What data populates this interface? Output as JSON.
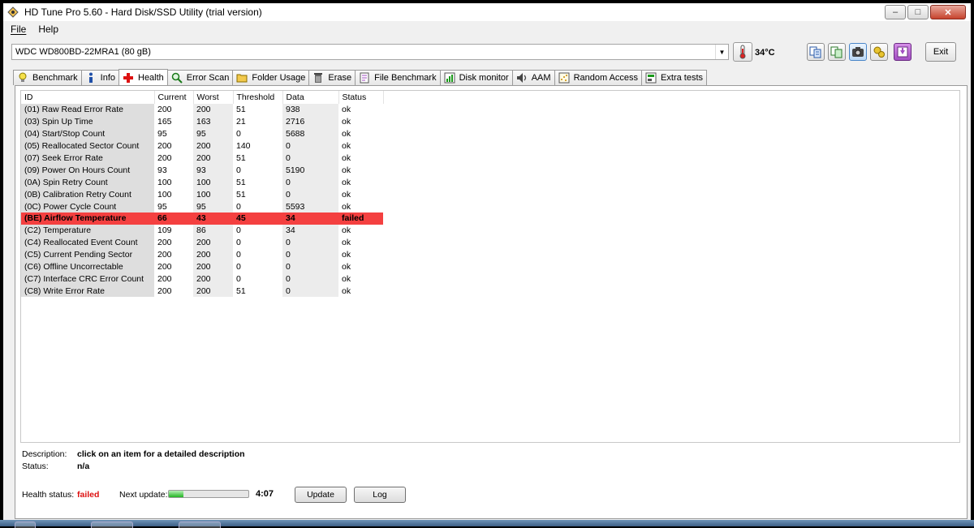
{
  "window": {
    "title": "HD Tune Pro 5.60 - Hard Disk/SSD Utility (trial version)",
    "controls": {
      "minimize": "–",
      "maximize": "□",
      "close": "✕"
    }
  },
  "menu": {
    "file": "File",
    "help": "Help"
  },
  "toolbar": {
    "drive": "WDC WD800BD-22MRA1 (80 gB)",
    "temperature": "34°C",
    "exit_label": "Exit",
    "buttons": [
      "copy-text-icon",
      "copy-screenshot-icon",
      "camera-icon",
      "options-icon",
      "save-icon"
    ]
  },
  "tabs": [
    {
      "label": "Benchmark",
      "icon": "lightbulb-icon"
    },
    {
      "label": "Info",
      "icon": "info-icon"
    },
    {
      "label": "Health",
      "icon": "red-cross-icon",
      "active": true
    },
    {
      "label": "Error Scan",
      "icon": "magnifier-icon"
    },
    {
      "label": "Folder Usage",
      "icon": "folder-icon"
    },
    {
      "label": "Erase",
      "icon": "trash-icon"
    },
    {
      "label": "File Benchmark",
      "icon": "file-benchmark-icon"
    },
    {
      "label": "Disk monitor",
      "icon": "chart-icon"
    },
    {
      "label": "AAM",
      "icon": "speaker-icon"
    },
    {
      "label": "Random Access",
      "icon": "scatter-icon"
    },
    {
      "label": "Extra tests",
      "icon": "tests-icon"
    }
  ],
  "health_table": {
    "headers": [
      "ID",
      "Current",
      "Worst",
      "Threshold",
      "Data",
      "Status"
    ],
    "rows": [
      {
        "id": "(01) Raw Read Error Rate",
        "current": "200",
        "worst": "200",
        "threshold": "51",
        "data": "938",
        "status": "ok"
      },
      {
        "id": "(03) Spin Up Time",
        "current": "165",
        "worst": "163",
        "threshold": "21",
        "data": "2716",
        "status": "ok"
      },
      {
        "id": "(04) Start/Stop Count",
        "current": "95",
        "worst": "95",
        "threshold": "0",
        "data": "5688",
        "status": "ok"
      },
      {
        "id": "(05) Reallocated Sector Count",
        "current": "200",
        "worst": "200",
        "threshold": "140",
        "data": "0",
        "status": "ok"
      },
      {
        "id": "(07) Seek Error Rate",
        "current": "200",
        "worst": "200",
        "threshold": "51",
        "data": "0",
        "status": "ok"
      },
      {
        "id": "(09) Power On Hours Count",
        "current": "93",
        "worst": "93",
        "threshold": "0",
        "data": "5190",
        "status": "ok"
      },
      {
        "id": "(0A) Spin Retry Count",
        "current": "100",
        "worst": "100",
        "threshold": "51",
        "data": "0",
        "status": "ok"
      },
      {
        "id": "(0B) Calibration Retry Count",
        "current": "100",
        "worst": "100",
        "threshold": "51",
        "data": "0",
        "status": "ok"
      },
      {
        "id": "(0C) Power Cycle Count",
        "current": "95",
        "worst": "95",
        "threshold": "0",
        "data": "5593",
        "status": "ok"
      },
      {
        "id": "(BE) Airflow Temperature",
        "current": "66",
        "worst": "43",
        "threshold": "45",
        "data": "34",
        "status": "failed"
      },
      {
        "id": "(C2) Temperature",
        "current": "109",
        "worst": "86",
        "threshold": "0",
        "data": "34",
        "status": "ok"
      },
      {
        "id": "(C4) Reallocated Event Count",
        "current": "200",
        "worst": "200",
        "threshold": "0",
        "data": "0",
        "status": "ok"
      },
      {
        "id": "(C5) Current Pending Sector",
        "current": "200",
        "worst": "200",
        "threshold": "0",
        "data": "0",
        "status": "ok"
      },
      {
        "id": "(C6) Offline Uncorrectable",
        "current": "200",
        "worst": "200",
        "threshold": "0",
        "data": "0",
        "status": "ok"
      },
      {
        "id": "(C7) Interface CRC Error Count",
        "current": "200",
        "worst": "200",
        "threshold": "0",
        "data": "0",
        "status": "ok"
      },
      {
        "id": "(C8) Write Error Rate",
        "current": "200",
        "worst": "200",
        "threshold": "51",
        "data": "0",
        "status": "ok"
      }
    ]
  },
  "details": {
    "description_label": "Description:",
    "description_value": "click on an item for a detailed description",
    "status_label": "Status:",
    "status_value": "n/a"
  },
  "footer": {
    "health_status_label": "Health status:",
    "health_status_value": "failed",
    "next_update_label": "Next update:",
    "progress_fraction": 0.18,
    "countdown": "4:07",
    "update_button": "Update",
    "log_button": "Log"
  },
  "colors": {
    "failed_row": "#f44040",
    "failed_text": "#d11111",
    "progress_fill": "#22b422"
  }
}
